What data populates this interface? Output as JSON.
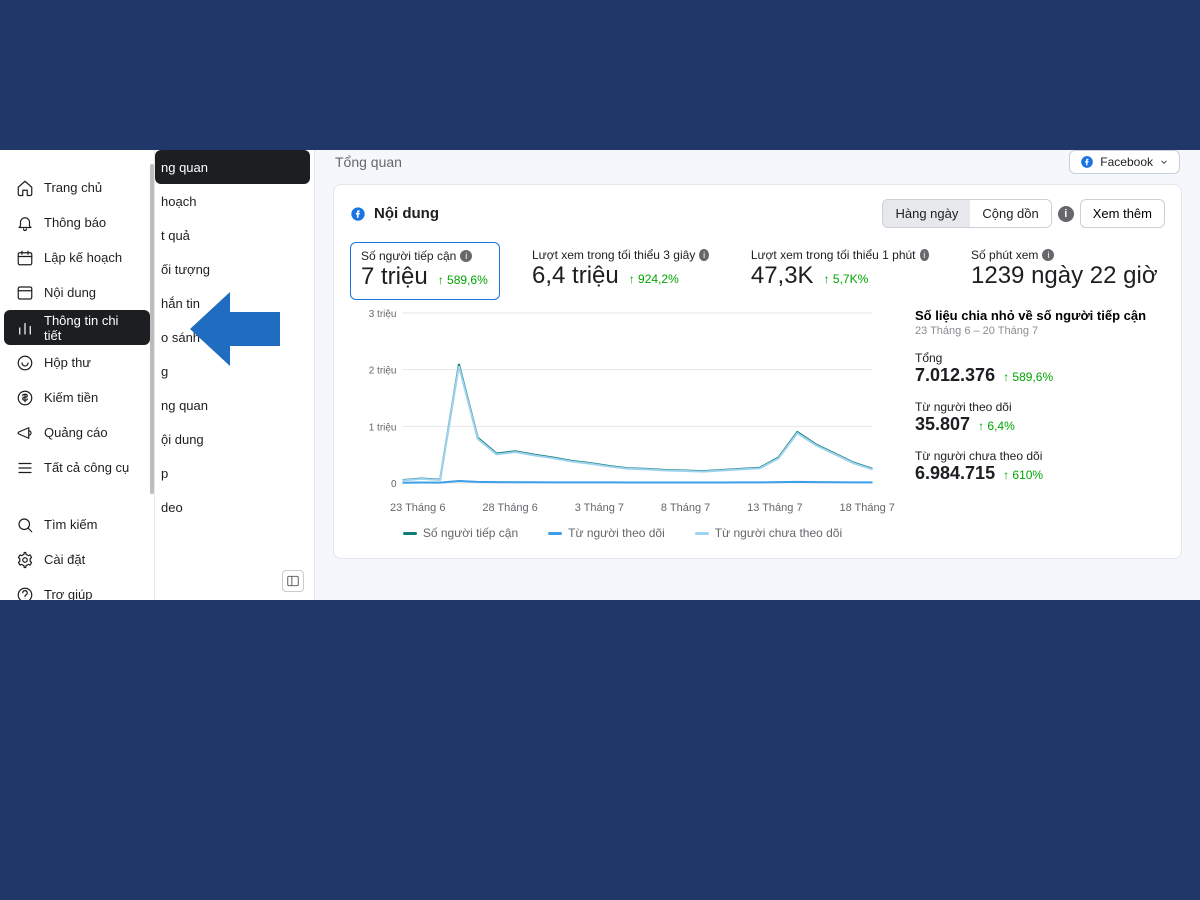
{
  "sidebar1": {
    "items": [
      {
        "label": "Trang chủ",
        "icon": "home"
      },
      {
        "label": "Thông báo",
        "icon": "bell"
      },
      {
        "label": "Lập kế hoạch",
        "icon": "calendar"
      },
      {
        "label": "Nội dung",
        "icon": "content"
      },
      {
        "label": "Thông tin chi tiết",
        "icon": "insights",
        "active": true
      },
      {
        "label": "Hộp thư",
        "icon": "inbox"
      },
      {
        "label": "Kiếm tiền",
        "icon": "money"
      },
      {
        "label": "Quảng cáo",
        "icon": "ads"
      },
      {
        "label": "Tất cả công cụ",
        "icon": "tools"
      }
    ],
    "bottom": [
      {
        "label": "Tìm kiếm",
        "icon": "search"
      },
      {
        "label": "Cài đặt",
        "icon": "settings"
      },
      {
        "label": "Trợ giúp",
        "icon": "help"
      }
    ]
  },
  "sidebar2": {
    "items": [
      {
        "label": "ng quan",
        "active": true
      },
      {
        "label": "hoạch"
      },
      {
        "label": "t quả"
      },
      {
        "label": "ối tượng"
      },
      {
        "label": "hắn tin"
      },
      {
        "label": "o sánh"
      },
      {
        "label": "g"
      },
      {
        "label": "ng quan"
      },
      {
        "label": "ội dung"
      },
      {
        "label": "p"
      },
      {
        "label": "deo"
      }
    ]
  },
  "header": {
    "page_title": "Tổng quan",
    "platform": "Facebook"
  },
  "card": {
    "title": "Nội dung",
    "seg": {
      "daily": "Hàng ngày",
      "cum": "Cộng dồn"
    },
    "view_more": "Xem thêm"
  },
  "metrics": [
    {
      "label": "Số người tiếp cận",
      "value": "7 triệu",
      "delta": "589,6%",
      "selected": true
    },
    {
      "label": "Lượt xem trong tối thiểu 3 giây",
      "value": "6,4 triệu",
      "delta": "924,2%"
    },
    {
      "label": "Lượt xem trong tối thiểu 1 phút",
      "value": "47,3K",
      "delta": "5,7K%"
    },
    {
      "label": "Số phút xem",
      "value": "1239 ngày 22 giờ",
      "delta": ""
    }
  ],
  "chart_data": {
    "type": "line",
    "title": "",
    "xlabel": "",
    "ylabel": "",
    "ylim": [
      0,
      3000000
    ],
    "yticks": [
      "0",
      "1 triệu",
      "2 triệu",
      "3 triệu"
    ],
    "categories": [
      "23 Tháng 6",
      "28 Tháng 6",
      "3 Tháng 7",
      "8 Tháng 7",
      "13 Tháng 7",
      "18 Tháng 7"
    ],
    "series": [
      {
        "name": "Số người tiếp cận",
        "color": "#0f7d77",
        "values": [
          50000,
          80000,
          60000,
          2100000,
          800000,
          520000,
          560000,
          500000,
          450000,
          390000,
          350000,
          300000,
          260000,
          250000,
          230000,
          220000,
          210000,
          230000,
          250000,
          270000,
          450000,
          900000,
          680000,
          520000,
          360000,
          250000
        ]
      },
      {
        "name": "Từ người theo dõi",
        "color": "#3ba0e6",
        "values": [
          5000,
          8000,
          6000,
          35000,
          20000,
          15000,
          14000,
          13000,
          12000,
          11000,
          10000,
          10000,
          9000,
          9000,
          9000,
          9000,
          9000,
          9000,
          10000,
          11000,
          15000,
          20000,
          16000,
          14000,
          12000,
          10000
        ]
      },
      {
        "name": "Từ người chưa theo dõi",
        "color": "#9ed2ef",
        "values": [
          45000,
          72000,
          54000,
          2065000,
          780000,
          505000,
          546000,
          487000,
          438000,
          379000,
          340000,
          290000,
          251000,
          241000,
          221000,
          211000,
          201000,
          221000,
          240000,
          259000,
          435000,
          880000,
          664000,
          506000,
          348000,
          240000
        ]
      }
    ]
  },
  "legend": [
    {
      "label": "Số người tiếp cận",
      "color": "#0f7d77"
    },
    {
      "label": "Từ người theo dõi",
      "color": "#3ba0e6"
    },
    {
      "label": "Từ người chưa theo dõi",
      "color": "#9ed2ef"
    }
  ],
  "stats": {
    "title": "Số liệu chia nhỏ về số người tiếp cận",
    "range": "23 Tháng 6 – 20 Tháng 7",
    "blocks": [
      {
        "label": "Tổng",
        "value": "7.012.376",
        "delta": "589,6%"
      },
      {
        "label": "Từ người theo dõi",
        "value": "35.807",
        "delta": "6,4%"
      },
      {
        "label": "Từ người chưa theo dõi",
        "value": "6.984.715",
        "delta": "610%"
      }
    ]
  },
  "colors": {
    "accent": "#1b74e4",
    "arrow": "#1f6cc0",
    "green": "#00a400"
  }
}
